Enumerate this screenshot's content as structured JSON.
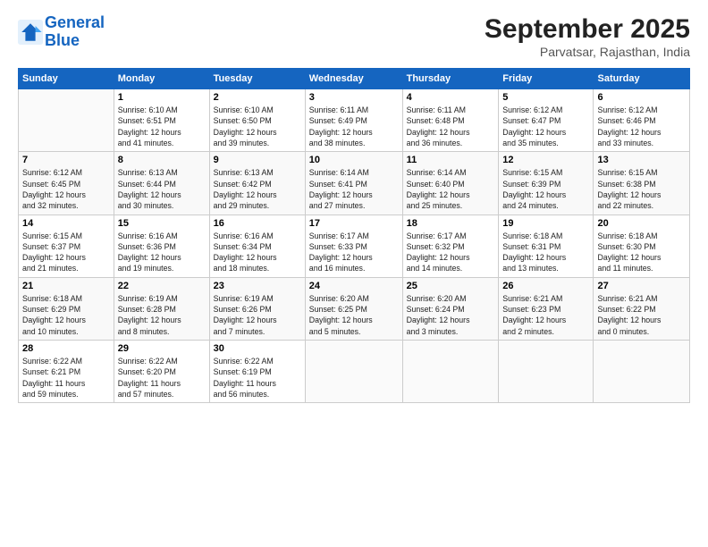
{
  "logo": {
    "line1": "General",
    "line2": "Blue"
  },
  "header": {
    "month": "September 2025",
    "location": "Parvatsar, Rajasthan, India"
  },
  "days_of_week": [
    "Sunday",
    "Monday",
    "Tuesday",
    "Wednesday",
    "Thursday",
    "Friday",
    "Saturday"
  ],
  "weeks": [
    [
      {
        "day": "",
        "info": ""
      },
      {
        "day": "1",
        "info": "Sunrise: 6:10 AM\nSunset: 6:51 PM\nDaylight: 12 hours\nand 41 minutes."
      },
      {
        "day": "2",
        "info": "Sunrise: 6:10 AM\nSunset: 6:50 PM\nDaylight: 12 hours\nand 39 minutes."
      },
      {
        "day": "3",
        "info": "Sunrise: 6:11 AM\nSunset: 6:49 PM\nDaylight: 12 hours\nand 38 minutes."
      },
      {
        "day": "4",
        "info": "Sunrise: 6:11 AM\nSunset: 6:48 PM\nDaylight: 12 hours\nand 36 minutes."
      },
      {
        "day": "5",
        "info": "Sunrise: 6:12 AM\nSunset: 6:47 PM\nDaylight: 12 hours\nand 35 minutes."
      },
      {
        "day": "6",
        "info": "Sunrise: 6:12 AM\nSunset: 6:46 PM\nDaylight: 12 hours\nand 33 minutes."
      }
    ],
    [
      {
        "day": "7",
        "info": "Sunrise: 6:12 AM\nSunset: 6:45 PM\nDaylight: 12 hours\nand 32 minutes."
      },
      {
        "day": "8",
        "info": "Sunrise: 6:13 AM\nSunset: 6:44 PM\nDaylight: 12 hours\nand 30 minutes."
      },
      {
        "day": "9",
        "info": "Sunrise: 6:13 AM\nSunset: 6:42 PM\nDaylight: 12 hours\nand 29 minutes."
      },
      {
        "day": "10",
        "info": "Sunrise: 6:14 AM\nSunset: 6:41 PM\nDaylight: 12 hours\nand 27 minutes."
      },
      {
        "day": "11",
        "info": "Sunrise: 6:14 AM\nSunset: 6:40 PM\nDaylight: 12 hours\nand 25 minutes."
      },
      {
        "day": "12",
        "info": "Sunrise: 6:15 AM\nSunset: 6:39 PM\nDaylight: 12 hours\nand 24 minutes."
      },
      {
        "day": "13",
        "info": "Sunrise: 6:15 AM\nSunset: 6:38 PM\nDaylight: 12 hours\nand 22 minutes."
      }
    ],
    [
      {
        "day": "14",
        "info": "Sunrise: 6:15 AM\nSunset: 6:37 PM\nDaylight: 12 hours\nand 21 minutes."
      },
      {
        "day": "15",
        "info": "Sunrise: 6:16 AM\nSunset: 6:36 PM\nDaylight: 12 hours\nand 19 minutes."
      },
      {
        "day": "16",
        "info": "Sunrise: 6:16 AM\nSunset: 6:34 PM\nDaylight: 12 hours\nand 18 minutes."
      },
      {
        "day": "17",
        "info": "Sunrise: 6:17 AM\nSunset: 6:33 PM\nDaylight: 12 hours\nand 16 minutes."
      },
      {
        "day": "18",
        "info": "Sunrise: 6:17 AM\nSunset: 6:32 PM\nDaylight: 12 hours\nand 14 minutes."
      },
      {
        "day": "19",
        "info": "Sunrise: 6:18 AM\nSunset: 6:31 PM\nDaylight: 12 hours\nand 13 minutes."
      },
      {
        "day": "20",
        "info": "Sunrise: 6:18 AM\nSunset: 6:30 PM\nDaylight: 12 hours\nand 11 minutes."
      }
    ],
    [
      {
        "day": "21",
        "info": "Sunrise: 6:18 AM\nSunset: 6:29 PM\nDaylight: 12 hours\nand 10 minutes."
      },
      {
        "day": "22",
        "info": "Sunrise: 6:19 AM\nSunset: 6:28 PM\nDaylight: 12 hours\nand 8 minutes."
      },
      {
        "day": "23",
        "info": "Sunrise: 6:19 AM\nSunset: 6:26 PM\nDaylight: 12 hours\nand 7 minutes."
      },
      {
        "day": "24",
        "info": "Sunrise: 6:20 AM\nSunset: 6:25 PM\nDaylight: 12 hours\nand 5 minutes."
      },
      {
        "day": "25",
        "info": "Sunrise: 6:20 AM\nSunset: 6:24 PM\nDaylight: 12 hours\nand 3 minutes."
      },
      {
        "day": "26",
        "info": "Sunrise: 6:21 AM\nSunset: 6:23 PM\nDaylight: 12 hours\nand 2 minutes."
      },
      {
        "day": "27",
        "info": "Sunrise: 6:21 AM\nSunset: 6:22 PM\nDaylight: 12 hours\nand 0 minutes."
      }
    ],
    [
      {
        "day": "28",
        "info": "Sunrise: 6:22 AM\nSunset: 6:21 PM\nDaylight: 11 hours\nand 59 minutes."
      },
      {
        "day": "29",
        "info": "Sunrise: 6:22 AM\nSunset: 6:20 PM\nDaylight: 11 hours\nand 57 minutes."
      },
      {
        "day": "30",
        "info": "Sunrise: 6:22 AM\nSunset: 6:19 PM\nDaylight: 11 hours\nand 56 minutes."
      },
      {
        "day": "",
        "info": ""
      },
      {
        "day": "",
        "info": ""
      },
      {
        "day": "",
        "info": ""
      },
      {
        "day": "",
        "info": ""
      }
    ]
  ]
}
